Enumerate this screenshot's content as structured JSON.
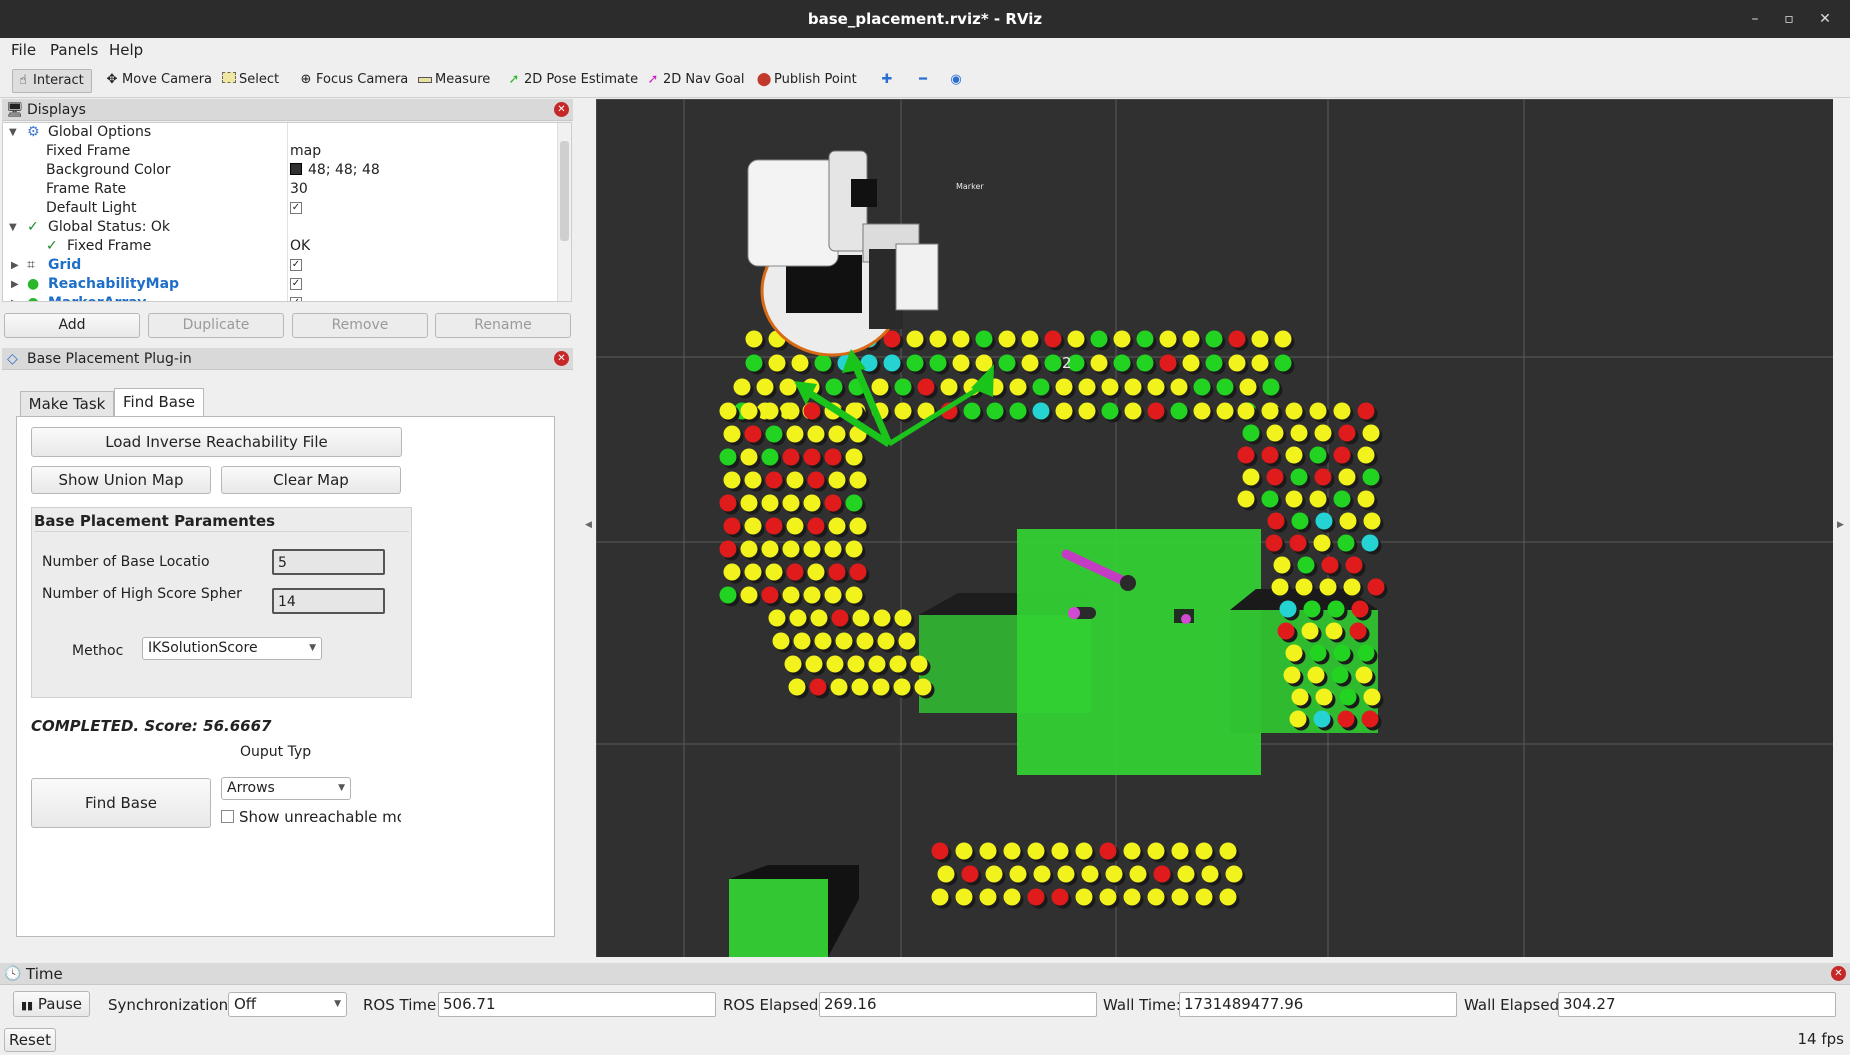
{
  "window": {
    "title": "base_placement.rviz* - RViz",
    "minimize": "–",
    "maximize": "▫",
    "close": "✕"
  },
  "menu": [
    "File",
    "Panels",
    "Help"
  ],
  "toolbar": {
    "tools": [
      "Interact",
      "Move Camera",
      "Select",
      "Focus Camera",
      "Measure",
      "2D Pose Estimate",
      "2D Nav Goal",
      "Publish Point"
    ],
    "active": "Interact",
    "icons": [
      "pointer-icon",
      "move-camera-icon",
      "select-icon",
      "focus-camera-icon",
      "measure-icon",
      "pose-estimate-icon",
      "nav-goal-icon",
      "publish-point-icon",
      "add-tool-icon",
      "remove-tool-icon",
      "view-icon"
    ]
  },
  "displays": {
    "title": "Displays",
    "rows": [
      {
        "key": "Global Options",
        "value": "",
        "level": 0,
        "expanded": true
      },
      {
        "key": "Fixed Frame",
        "value": "map",
        "level": 1
      },
      {
        "key": "Background Color",
        "value": "48; 48; 48",
        "level": 1,
        "swatch": "#303030"
      },
      {
        "key": "Frame Rate",
        "value": "30",
        "level": 1
      },
      {
        "key": "Default Light",
        "value": "✓",
        "level": 1
      },
      {
        "key": "Global Status: Ok",
        "value": "",
        "level": 0,
        "expanded": true
      },
      {
        "key": "Fixed Frame",
        "value": "OK",
        "level": 1
      },
      {
        "key": "Grid",
        "value": "✓",
        "level": 0,
        "display": true
      },
      {
        "key": "ReachabilityMap",
        "value": "✓",
        "level": 0,
        "display": true
      },
      {
        "key": "MarkerArray",
        "value": "✓",
        "level": 0,
        "display": true
      }
    ],
    "buttons": [
      "Add",
      "Duplicate",
      "Remove",
      "Rename"
    ]
  },
  "plugin": {
    "title": "Base Placement Plug-in",
    "tabs": [
      "Make Task",
      "Find Base"
    ],
    "active_tab": "Find Base",
    "load_btn": "Load Inverse Reachability File",
    "union_btn": "Show Union Map",
    "clear_btn": "Clear Map",
    "group_title": "Base Placement Paramentes",
    "num_base_label": "Number of Base Locatio",
    "num_base_value": "5",
    "num_high_label": "Number of High Score Spher",
    "num_high_value": "14",
    "method_label": "Methoc",
    "method_value": "IKSolutionScore",
    "status": "COMPLETED. Score: 56.6667",
    "output_label": "Ouput Typ",
    "output_value": "Arrows",
    "find_btn": "Find Base",
    "unreachable_label": "Show unreachable mode"
  },
  "viewport": {
    "marker_label": "Marker",
    "arrow_label": "2",
    "fps": "14 fps",
    "background": "#303030"
  },
  "time": {
    "title": "Time",
    "pause": "Pause",
    "sync_label": "Synchronization:",
    "sync_value": "Off",
    "ros_time_label": "ROS Time:",
    "ros_time": "506.71",
    "ros_elapsed_label": "ROS Elapsed:",
    "ros_elapsed": "269.16",
    "wall_time_label": "Wall Time:",
    "wall_time": "1731489477.96",
    "wall_elapsed_label": "Wall Elapsed:",
    "wall_elapsed": "304.27",
    "reset": "Reset"
  }
}
